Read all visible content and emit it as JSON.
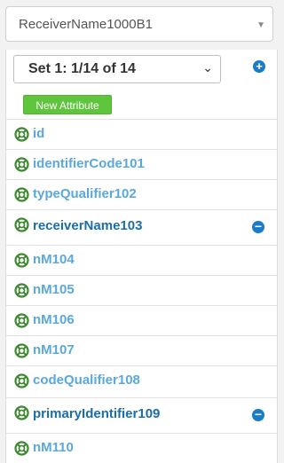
{
  "top_select": {
    "value": "ReceiverName1000B1"
  },
  "set_select": {
    "value": "Set 1: 1/14 of 14"
  },
  "new_attribute_label": "New Attribute",
  "attributes": [
    {
      "label": "id"
    },
    {
      "label": "identifierCode101"
    },
    {
      "label": "typeQualifier102"
    },
    {
      "label": "receiverName103"
    },
    {
      "label": "nM104"
    },
    {
      "label": "nM105"
    },
    {
      "label": "nM106"
    },
    {
      "label": "nM107"
    },
    {
      "label": "codeQualifier108"
    },
    {
      "label": "primaryIdentifier109"
    },
    {
      "label": "nM110"
    }
  ],
  "colors": {
    "link": "#5aa8dc",
    "active": "#1a6ea8",
    "green": "#5fc53d",
    "icon_green": "#3c8a2e",
    "blue_button": "#1a7cc4"
  },
  "icons": {
    "row_icon": "life-ring-icon",
    "add": "plus-circle-icon",
    "remove": "minus-circle-icon"
  }
}
